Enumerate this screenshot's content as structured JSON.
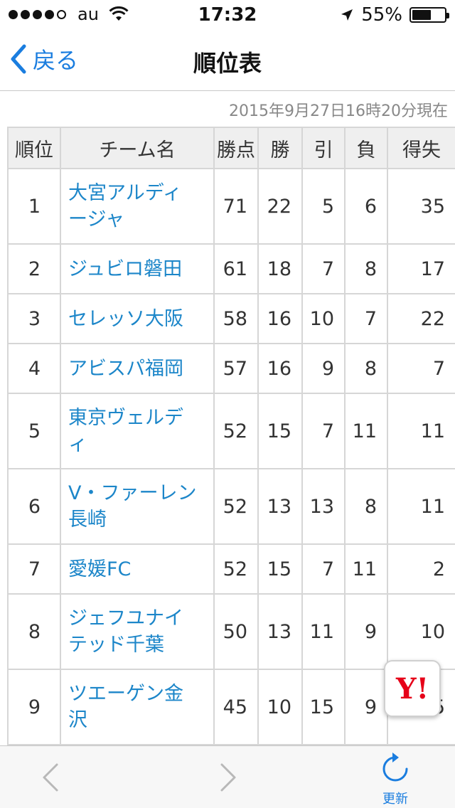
{
  "status_bar": {
    "carrier": "au",
    "time": "17:32",
    "battery": "55%"
  },
  "nav": {
    "back_label": "戻る",
    "title": "順位表"
  },
  "timestamp": "2015年9月27日16時20分現在",
  "table": {
    "headers": [
      "順位",
      "チーム名",
      "勝点",
      "勝",
      "引",
      "負",
      "得失"
    ],
    "rows": [
      {
        "rank": "1",
        "team": [
          "大宮アルディ",
          "ージャ"
        ],
        "pts": "71",
        "w": "22",
        "d": "5",
        "l": "6",
        "gd": "35"
      },
      {
        "rank": "2",
        "team": [
          "ジュビロ磐田"
        ],
        "pts": "61",
        "w": "18",
        "d": "7",
        "l": "8",
        "gd": "17"
      },
      {
        "rank": "3",
        "team": [
          "セレッソ大阪"
        ],
        "pts": "58",
        "w": "16",
        "d": "10",
        "l": "7",
        "gd": "22"
      },
      {
        "rank": "4",
        "team": [
          "アビスパ福岡"
        ],
        "pts": "57",
        "w": "16",
        "d": "9",
        "l": "8",
        "gd": "7"
      },
      {
        "rank": "5",
        "team": [
          "東京ヴェルデ",
          "ィ"
        ],
        "pts": "52",
        "w": "15",
        "d": "7",
        "l": "11",
        "gd": "11"
      },
      {
        "rank": "6",
        "team": [
          "V・ファーレン",
          "長崎"
        ],
        "pts": "52",
        "w": "13",
        "d": "13",
        "l": "8",
        "gd": "11"
      },
      {
        "rank": "7",
        "team": [
          "愛媛FC"
        ],
        "pts": "52",
        "w": "15",
        "d": "7",
        "l": "11",
        "gd": "2"
      },
      {
        "rank": "8",
        "team": [
          "ジェフユナイ",
          "テッド千葉"
        ],
        "pts": "50",
        "w": "13",
        "d": "11",
        "l": "9",
        "gd": "10"
      },
      {
        "rank": "9",
        "team": [
          "ツエーゲン金",
          "沢"
        ],
        "pts": "45",
        "w": "10",
        "d": "15",
        "l": "9",
        "gd": "5"
      }
    ]
  },
  "yahoo_badge": "Y!",
  "toolbar": {
    "reload_label": "更新"
  },
  "colors": {
    "accent": "#1a7ddf",
    "team_link": "#1c86c9",
    "yahoo_red": "#e60019"
  },
  "icons": [
    "wifi-icon",
    "location-arrow-icon",
    "battery-icon",
    "chevron-left-icon",
    "chevron-right-icon",
    "reload-icon"
  ]
}
